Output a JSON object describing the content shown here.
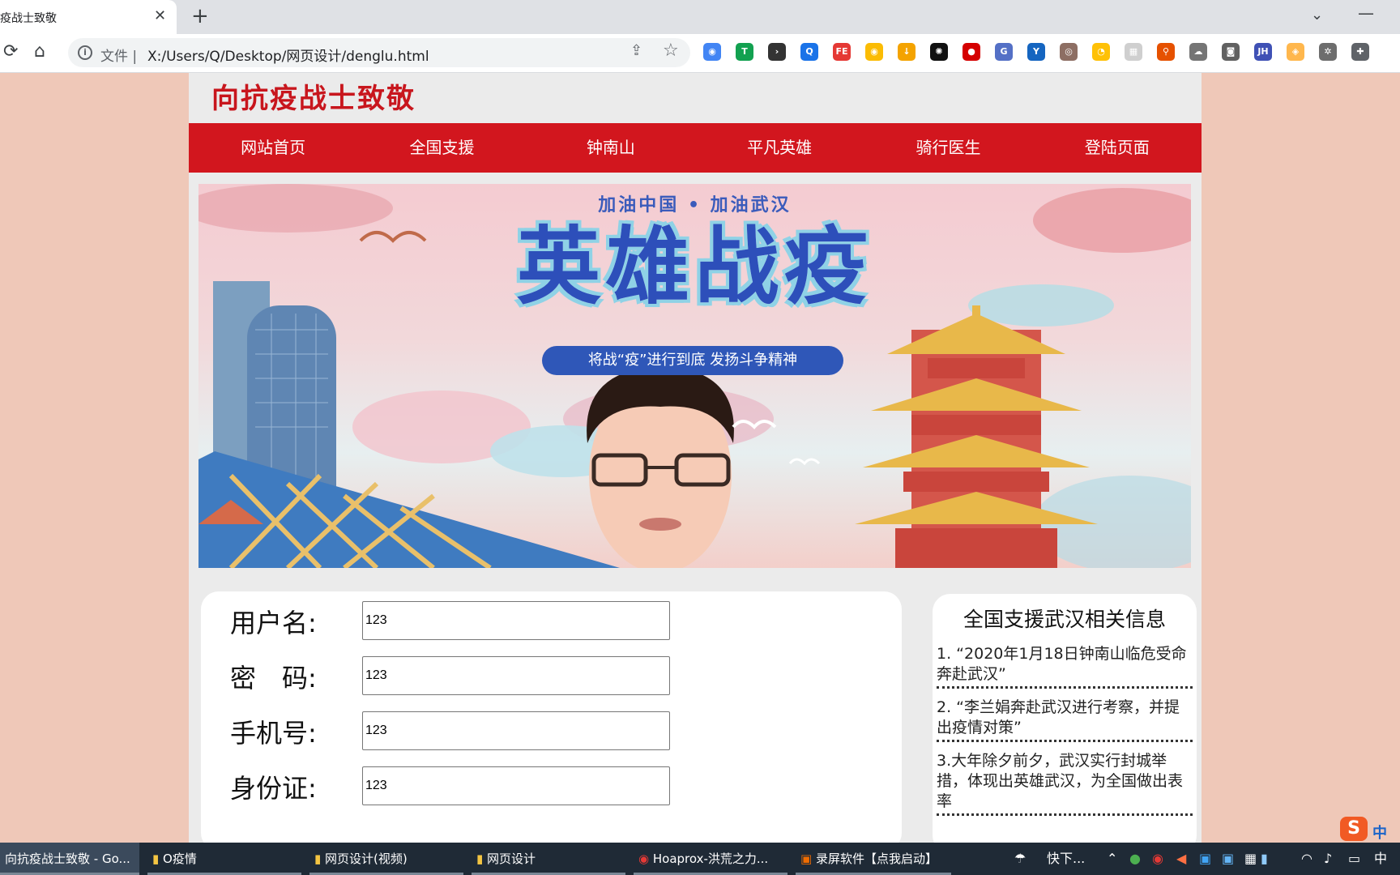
{
  "browser": {
    "tab_title": "疫战士致敬",
    "tab_close": "✕",
    "new_tab": "+",
    "window_chevron": "⌄",
    "window_min": "—",
    "url_scheme": "文件 |",
    "url": "X:/Users/Q/Desktop/网页设计/denglu.html",
    "extensions": [
      {
        "name": "chrome-ext-icon",
        "color": "#4285f4",
        "glyph": "◉"
      },
      {
        "name": "shield-ext-icon",
        "color": "#12a150",
        "glyph": "T"
      },
      {
        "name": "arrow-ext-icon",
        "color": "#333333",
        "glyph": "›"
      },
      {
        "name": "search-ext-icon",
        "color": "#1a73e8",
        "glyph": "Q"
      },
      {
        "name": "fe-ext-icon",
        "color": "#e53935",
        "glyph": "FE"
      },
      {
        "name": "chrome2-ext-icon",
        "color": "#fbbc04",
        "glyph": "◉"
      },
      {
        "name": "download-ext-icon",
        "color": "#f4a300",
        "glyph": "↓"
      },
      {
        "name": "openai-ext-icon",
        "color": "#111111",
        "glyph": "✺"
      },
      {
        "name": "adblock-ext-icon",
        "color": "#d50000",
        "glyph": "●"
      },
      {
        "name": "g-ext-icon",
        "color": "#5470c6",
        "glyph": "G"
      },
      {
        "name": "y-ext-icon",
        "color": "#1565c0",
        "glyph": "Y"
      },
      {
        "name": "owl-ext-icon",
        "color": "#8d6e63",
        "glyph": "◎"
      },
      {
        "name": "yellow-ext-icon",
        "color": "#ffc107",
        "glyph": "◔"
      },
      {
        "name": "grid-ext-icon",
        "color": "#cfcfcf",
        "glyph": "▦"
      },
      {
        "name": "tree-ext-icon",
        "color": "#e65100",
        "glyph": "⚲"
      },
      {
        "name": "cloud-ext-icon",
        "color": "#757575",
        "glyph": "☁"
      },
      {
        "name": "camera-ext-icon",
        "color": "#616161",
        "glyph": "◙"
      },
      {
        "name": "jh-ext-icon",
        "color": "#3f51b5",
        "glyph": "JH"
      },
      {
        "name": "orange-ext-icon",
        "color": "#ffb74d",
        "glyph": "◈"
      },
      {
        "name": "settings-ext-icon",
        "color": "#6d6d6d",
        "glyph": "✲"
      },
      {
        "name": "puzzle-ext-icon",
        "color": "#5f6368",
        "glyph": "✚"
      }
    ]
  },
  "site": {
    "title": "向抗疫战士致敬",
    "nav": [
      "网站首页",
      "全国支援",
      "钟南山",
      "平凡英雄",
      "骑行医生",
      "登陆页面"
    ]
  },
  "banner": {
    "top_line": "加油中国 • 加油武汉",
    "headline": "英雄战疫",
    "slogan": "将战“疫”进行到底  发扬斗争精神"
  },
  "form": {
    "fields": [
      {
        "label": "用户名:",
        "value": "123"
      },
      {
        "label": "密　码:",
        "value": "123"
      },
      {
        "label": "手机号:",
        "value": "123"
      },
      {
        "label": "身份证:",
        "value": "123"
      }
    ]
  },
  "info": {
    "title": "全国支援武汉相关信息",
    "items": [
      "1. “2020年1月18日钟南山临危受命奔赴武汉”",
      "2. “李兰娟奔赴武汉进行考察，并提出疫情对策”",
      "3.大年除夕前夕，武汉实行封城举措，体现出英雄武汉，为全国做出表率"
    ]
  },
  "taskbar": {
    "tasks": [
      "向抗疫战士致敬 - Go...",
      "O疫情",
      "网页设计(视频)",
      "网页设计",
      "Hoaprox-洪荒之力...",
      "录屏软件【点我启动】"
    ],
    "weather": "快下...",
    "ime": "中",
    "tray_ime": "中"
  }
}
